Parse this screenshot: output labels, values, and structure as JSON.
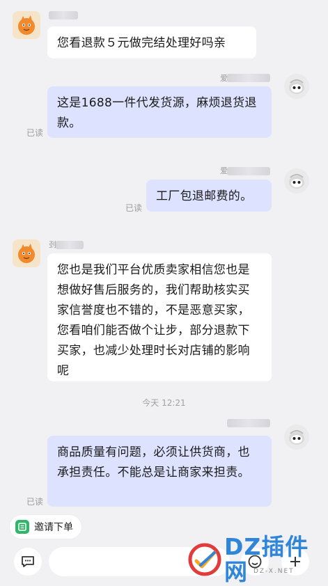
{
  "messages": [
    {
      "side": "in",
      "text": "您看退款５元做完结处理好吗亲"
    },
    {
      "side": "out",
      "text": "这是1688一件代发货源，麻烦退货退款。",
      "status": "已读"
    },
    {
      "side": "out",
      "text": "工厂包退邮费的。",
      "status": "已读"
    },
    {
      "side": "in",
      "text": "您也是我们平台优质卖家相信您也是想做好售后服务的，我们帮助核实买家信誉度也不错的，不是恶意买家，您看咱们能否做个让步，部分退款下买家，也减少处理时长对店铺的影响呢"
    },
    {
      "side": "out",
      "text": "商品质量有问题，必须让供货商，也承担责任。不能总是让商家来担责。",
      "status": "已读"
    }
  ],
  "timestamp": "今天 12:21",
  "name_initials": {
    "seller_2": "刭",
    "buyer_1": "爱",
    "buyer_2": "爱"
  },
  "quick_action": {
    "label": "邀请下单",
    "icon": "order-invite-icon"
  },
  "composer": {
    "placeholder": ""
  },
  "watermark": {
    "logo_text": "DZ插件网",
    "sub_text": "DZ-X.NET"
  },
  "colors": {
    "background": "#f1f1f4",
    "incoming_bubble": "#ffffff",
    "outgoing_bubble": "#dde3ff",
    "read_status": "#9a9a9a",
    "watermark_blue": "#2f86d9"
  }
}
